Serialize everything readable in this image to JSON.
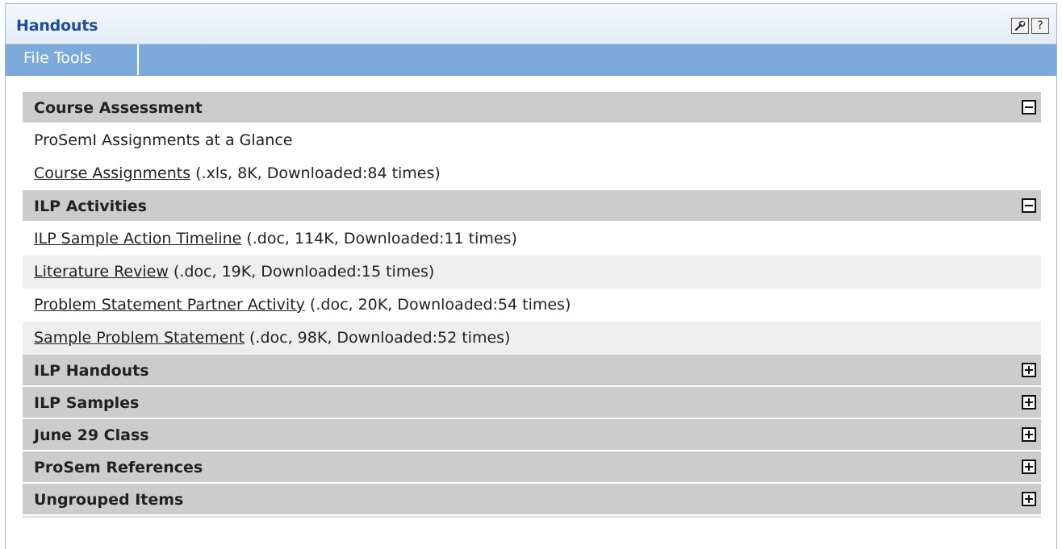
{
  "window": {
    "title": "Handouts",
    "tools_icon": "wrench-icon",
    "help_label": "?"
  },
  "tabs": [
    {
      "label": "File Tools"
    }
  ],
  "groups": [
    {
      "title": "Course Assessment",
      "state": "expanded",
      "items": [
        {
          "text": "ProSemI Assignments at a Glance",
          "link": "",
          "meta": ""
        },
        {
          "text": "",
          "link": "Course Assignments",
          "meta": " (.xls, 8K, Downloaded:84 times)"
        }
      ]
    },
    {
      "title": "ILP Activities",
      "state": "expanded",
      "items": [
        {
          "text": "",
          "link": "ILP Sample Action Timeline",
          "meta": " (.doc, 114K, Downloaded:11 times)"
        },
        {
          "text": "",
          "link": "Literature Review",
          "meta": " (.doc, 19K, Downloaded:15 times)"
        },
        {
          "text": "",
          "link": "Problem Statement Partner Activity",
          "meta": " (.doc, 20K, Downloaded:54 times)"
        },
        {
          "text": "",
          "link": "Sample Problem Statement",
          "meta": " (.doc, 98K, Downloaded:52 times)"
        }
      ]
    },
    {
      "title": "ILP Handouts",
      "state": "collapsed",
      "items": []
    },
    {
      "title": "ILP Samples",
      "state": "collapsed",
      "items": []
    },
    {
      "title": "June 29 Class",
      "state": "collapsed",
      "items": []
    },
    {
      "title": "ProSem References",
      "state": "collapsed",
      "items": []
    },
    {
      "title": "Ungrouped Items",
      "state": "collapsed",
      "items": []
    }
  ],
  "colors": {
    "title": "#1d4d9b",
    "tabbar": "#7eaadb",
    "group_header": "#cccccc",
    "alt_row": "#eeeeee"
  }
}
